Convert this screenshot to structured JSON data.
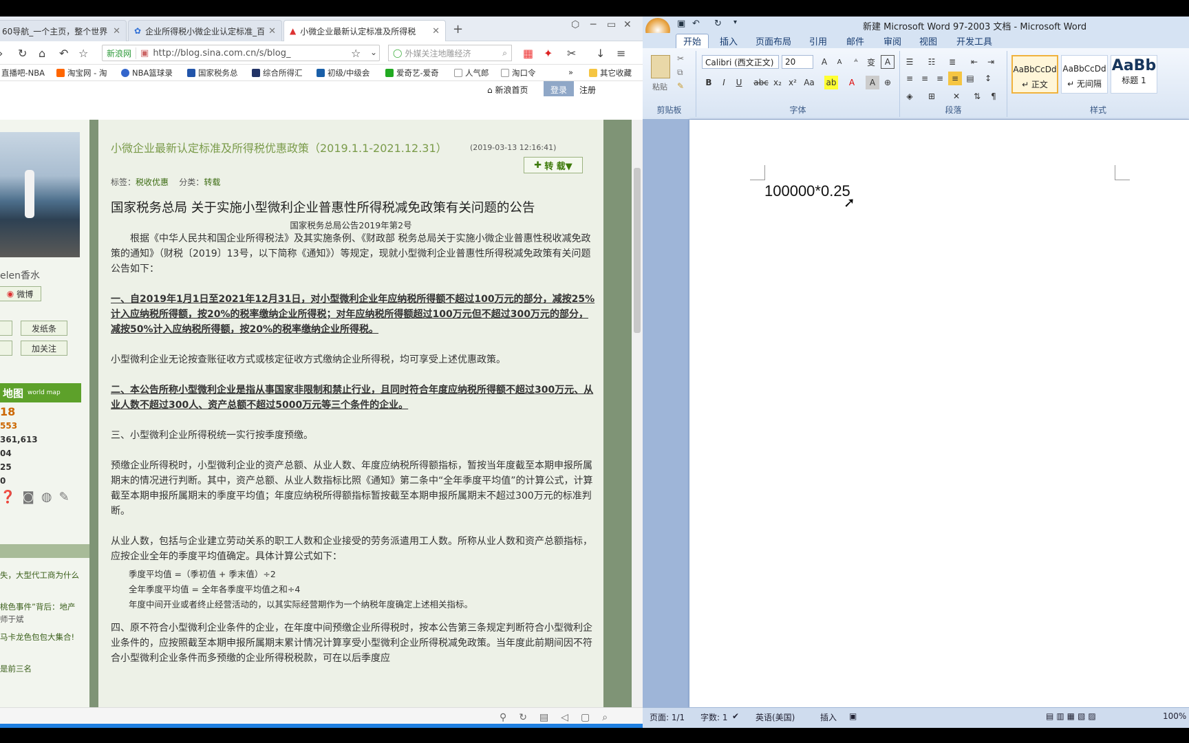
{
  "browser": {
    "tabs": [
      {
        "label": "60导航_一个主页，整个世界",
        "icon": "globe-icon"
      },
      {
        "label": "企业所得税小微企业认定标准_百",
        "icon": "paw-icon"
      },
      {
        "label": "小微企业最新认定标准及所得税",
        "icon": "sina-icon"
      }
    ],
    "address": {
      "badge": "新浪网",
      "url": "http://blog.sina.com.cn/s/blog_"
    },
    "search_placeholder": "外媒关注地雕经济",
    "bookmarks": [
      "直播吧-NBA",
      "淘宝网 - 淘",
      "NBA篮球录",
      "国家税务总",
      "综合所得汇",
      "初级/中级会",
      "爱奇艺-爱奇",
      "人气郎",
      "淘口令",
      "»",
      "其它收藏"
    ],
    "site_links": {
      "home": "新浪首页",
      "login": "登录",
      "register": "注册"
    }
  },
  "blog": {
    "username": "elen香水",
    "weibo": "微博",
    "btn_note": "发纸条",
    "btn_follow": "加关注",
    "worldmap": "地图",
    "worldmap_sub": "world map",
    "stats": [
      "18",
      "553",
      "361,613",
      "04",
      "25",
      "0"
    ],
    "side_links": [
      "失，大型代工商为什么",
      "桃色事件”背后：地产",
      "师于斌",
      "马卡龙色包包大集合!",
      "是前三名"
    ],
    "title": "小微企业最新认定标准及所得税优惠政策（2019.1.1-2021.12.31）",
    "date": "(2019-03-13 12:16:41)",
    "repost": "转 载▼",
    "tags_label": "标签：",
    "tag": "税收优惠",
    "cat_label": "分类：",
    "category": "转载",
    "main_title": "国家税务总局 关于实施小型微利企业普惠性所得税减免政策有关问题的公告",
    "sub_title": "国家税务总局公告2019年第2号",
    "p1": "根据《中华人民共和国企业所得税法》及其实施条例、《财政部 税务总局关于实施小微企业普惠性税收减免政策的通知》（财税〔2019〕13号，以下简称《通知》）等规定，现就小型微利企业普惠性所得税减免政策有关问题公告如下：",
    "p2": "一、自2019年1月1日至2021年12月31日，对小型微利企业年应纳税所得额不超过100万元的部分，减按25%计入应纳税所得额，按20%的税率缴纳企业所得税；对年应纳税所得额超过100万元但不超过300万元的部分，减按50%计入应纳税所得额，按20%的税率缴纳企业所得税。",
    "p3": "小型微利企业无论按查账征收方式或核定征收方式缴纳企业所得税，均可享受上述优惠政策。",
    "p4": "二、本公告所称小型微利企业是指从事国家非限制和禁止行业，且同时符合年度应纳税所得额不超过300万元、从业人数不超过300人、资产总额不超过5000万元等三个条件的企业。",
    "p5": "三、小型微利企业所得税统一实行按季度预缴。",
    "p6": "预缴企业所得税时，小型微利企业的资产总额、从业人数、年度应纳税所得额指标，暂按当年度截至本期申报所属期末的情况进行判断。其中，资产总额、从业人数指标比照《通知》第二条中“全年季度平均值”的计算公式，计算截至本期申报所属期末的季度平均值；年度应纳税所得额指标暂按截至本期申报所属期末不超过300万元的标准判断。",
    "p7": "从业人数，包括与企业建立劳动关系的职工人数和企业接受的劳务派遣用工人数。所称从业人数和资产总额指标，应按企业全年的季度平均值确定。具体计算公式如下：",
    "f1": "季度平均值 =（季初值 + 季末值）÷2",
    "f2": "全年季度平均值 = 全年各季度平均值之和÷4",
    "f3": "年度中间开业或者终止经营活动的，以其实际经营期作为一个纳税年度确定上述相关指标。",
    "p8": "四、原不符合小型微利企业条件的企业，在年度中间预缴企业所得税时，按本公告第三条规定判断符合小型微利企业条件的，应按照截至本期申报所属期末累计情况计算享受小型微利企业所得税减免政策。当年度此前期间因不符合小型微利企业条件而多预缴的企业所得税税款，可在以后季度应"
  },
  "word": {
    "title": "新建 Microsoft Word 97-2003 文档 - Microsoft Word",
    "tabs": [
      "开始",
      "插入",
      "页面布局",
      "引用",
      "邮件",
      "审阅",
      "视图",
      "开发工具"
    ],
    "font_name": "Calibri (西文正文)",
    "font_size": "20",
    "groups": [
      "剪贴板",
      "字体",
      "段落",
      "样式"
    ],
    "paste": "粘贴",
    "styles": [
      {
        "preview": "AaBbCcDd",
        "name": "↵ 正文"
      },
      {
        "preview": "AaBbCcDd",
        "name": "↵ 无间隔"
      },
      {
        "preview": "AaBb",
        "name": "标题 1"
      }
    ],
    "doc_text": "100000*0.25",
    "status": {
      "page": "页面: 1/1",
      "words": "字数: 1",
      "lang": "英语(美国)",
      "insert": "插入",
      "zoom": "100%"
    }
  }
}
